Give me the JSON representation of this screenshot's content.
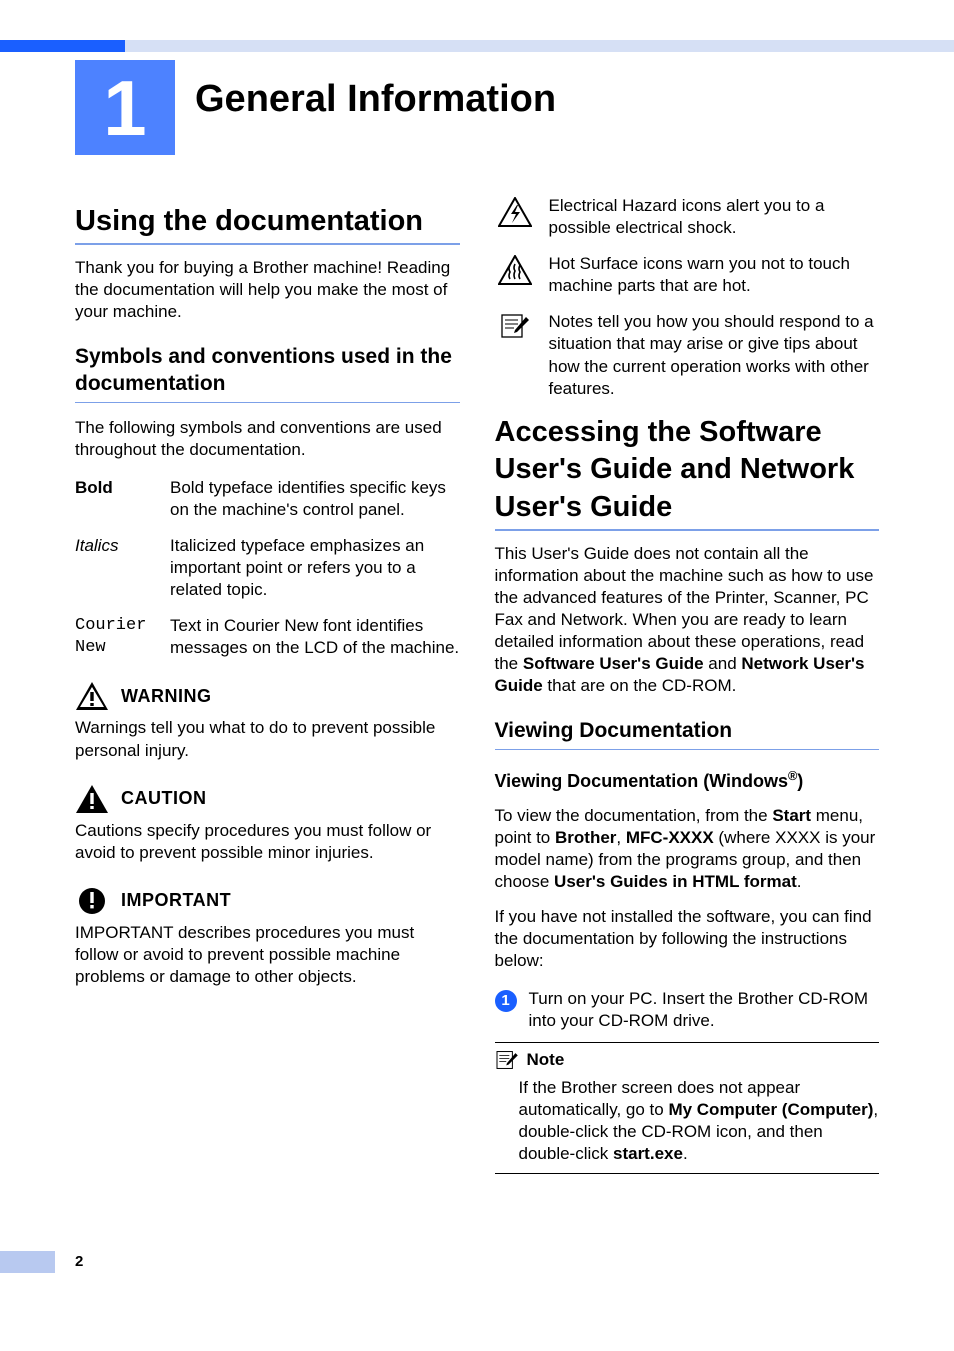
{
  "chapter": {
    "number": "1",
    "title": "General Information"
  },
  "left": {
    "h2": "Using the documentation",
    "intro": "Thank you for buying a Brother machine! Reading the documentation will help you make the most of your machine.",
    "h3": "Symbols and conventions used in the documentation",
    "lead": "The following symbols and conventions are used throughout the documentation.",
    "sym": {
      "boldLabel": "Bold",
      "boldDesc": "Bold typeface identifies specific keys on the machine's control panel.",
      "italicsLabel": "Italics",
      "italicsDesc": "Italicized typeface emphasizes an important point or refers you to a related topic.",
      "courierLabel": "Courier New",
      "courierDesc": "Text in Courier New font identifies messages on the LCD of the machine."
    },
    "alerts": {
      "warning": {
        "title": "WARNING",
        "body": "Warnings tell you what to do to prevent possible personal injury."
      },
      "caution": {
        "title": "CAUTION",
        "body": "Cautions specify procedures you must follow or avoid to prevent possible minor injuries."
      },
      "important": {
        "title": "IMPORTANT",
        "body": "IMPORTANT describes procedures you must follow or avoid to prevent possible machine problems or damage to other objects."
      }
    }
  },
  "right": {
    "icons": {
      "electrical": "Electrical Hazard icons alert you to a possible electrical shock.",
      "hot": "Hot Surface icons warn you not to touch machine parts that are hot.",
      "notes": "Notes tell you how you should respond to a situation that may arise or give tips about how the current operation works with other features."
    },
    "h2": "Accessing the Software User's Guide and Network User's Guide",
    "para1_a": "This User's Guide does not contain all the information about the machine such as how to use the advanced features of the Printer, Scanner, PC Fax and Network. When you are ready to learn detailed information about these operations, read the ",
    "para1_b": "Software User's Guide",
    "para1_c": " and ",
    "para1_d": "Network User's Guide",
    "para1_e": " that are on the CD-ROM.",
    "h3": "Viewing Documentation",
    "h4_pre": "Viewing Documentation (Windows",
    "h4_sup": "®",
    "h4_post": ")",
    "view_a": "To view the documentation, from the ",
    "view_b": "Start",
    "view_c": " menu, point to ",
    "view_d": "Brother",
    "view_e": ", ",
    "view_f": "MFC-XXXX",
    "view_g": " (where XXXX is your model name) from the programs group, and then choose ",
    "view_h": "User's Guides in HTML format",
    "view_i": ".",
    "noinstall": "If you have not installed the software, you can find the documentation by following the instructions below:",
    "step1": {
      "num": "1",
      "text": "Turn on your PC. Insert the Brother CD-ROM into your CD-ROM drive."
    },
    "note": {
      "title": "Note",
      "a": "If the Brother screen does not appear automatically, go to ",
      "b": "My Computer (Computer)",
      "c": ", double-click the CD-ROM icon, and then double-click ",
      "d": "start.exe",
      "e": "."
    }
  },
  "pageNumber": "2"
}
